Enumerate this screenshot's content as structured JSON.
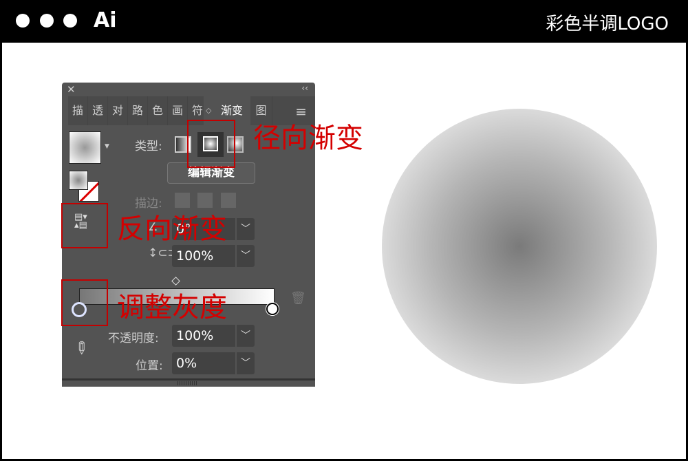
{
  "window": {
    "app_name": "Ai",
    "title": "彩色半调LOGO"
  },
  "panel": {
    "close_icon": "close-icon",
    "collapse_icon": "double-chevron-left-icon",
    "tabs": [
      "描",
      "透",
      "对",
      "路",
      "色",
      "画",
      "符",
      "渐变",
      "图"
    ],
    "active_tab": "渐变",
    "type_label": "类型:",
    "edit_gradient": "编辑渐变",
    "stroke_label": "描边:",
    "angle": "0°",
    "aspect": "100%",
    "opacity_label": "不透明度:",
    "opacity": "100%",
    "location_label": "位置:",
    "location": "0%",
    "gradient_type": "radial"
  },
  "annotations": {
    "radial": "径向渐变",
    "reverse": "反向渐变",
    "gray": "调整灰度",
    "color": "#c40000"
  }
}
